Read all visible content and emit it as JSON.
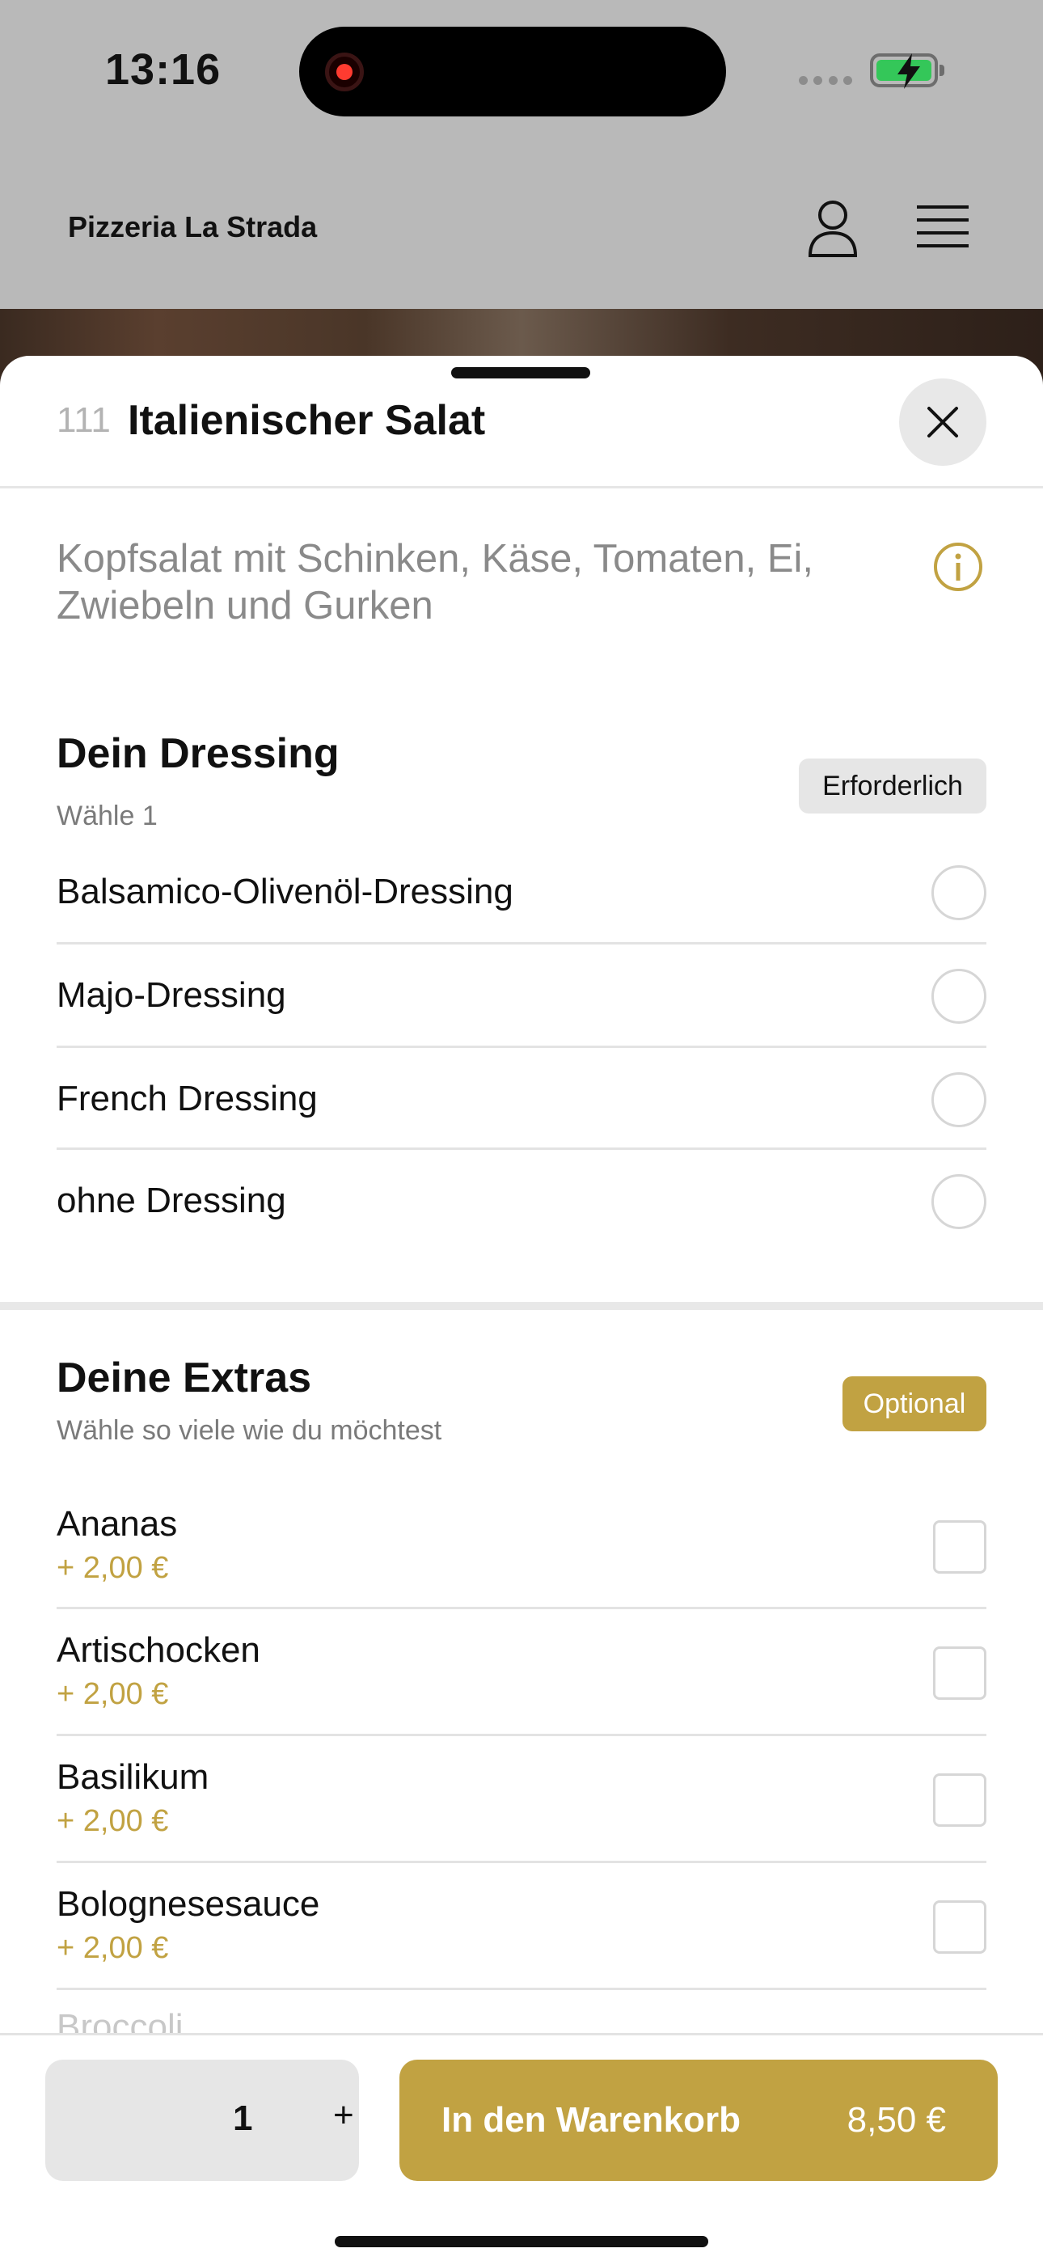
{
  "status_bar": {
    "time": "13:16"
  },
  "app_header": {
    "brand": "Pizzeria La Strada"
  },
  "item": {
    "number": "111",
    "title": "Italienischer Salat",
    "description": "Kopfsalat mit Schinken, Käse, Tomaten, Ei, Zwiebeln und Gurken"
  },
  "dressing": {
    "title": "Dein Dressing",
    "subtitle": "Wähle 1",
    "badge": "Erforderlich",
    "options": [
      {
        "label": "Balsamico-Olivenöl-Dressing"
      },
      {
        "label": "Majo-Dressing"
      },
      {
        "label": "French Dressing"
      },
      {
        "label": "ohne Dressing"
      }
    ]
  },
  "extras": {
    "title": "Deine Extras",
    "subtitle": "Wähle so viele wie du möchtest",
    "badge": "Optional",
    "options": [
      {
        "label": "Ananas",
        "price": "+ 2,00 €"
      },
      {
        "label": "Artischocken",
        "price": "+ 2,00 €"
      },
      {
        "label": "Basilikum",
        "price": "+ 2,00 €"
      },
      {
        "label": "Bolognesesauce",
        "price": "+ 2,00 €"
      },
      {
        "label": "Broccoli"
      }
    ]
  },
  "bottom_bar": {
    "quantity": "1",
    "plus": "+",
    "cart_label": "In den Warenkorb",
    "cart_price": "8,50 €"
  },
  "colors": {
    "accent": "#c1a242",
    "overlay": "#b9b9b9",
    "battery": "#34c759"
  },
  "icons": [
    "user-icon",
    "menu-icon",
    "close-icon",
    "info-icon",
    "battery-icon",
    "record-icon"
  ]
}
